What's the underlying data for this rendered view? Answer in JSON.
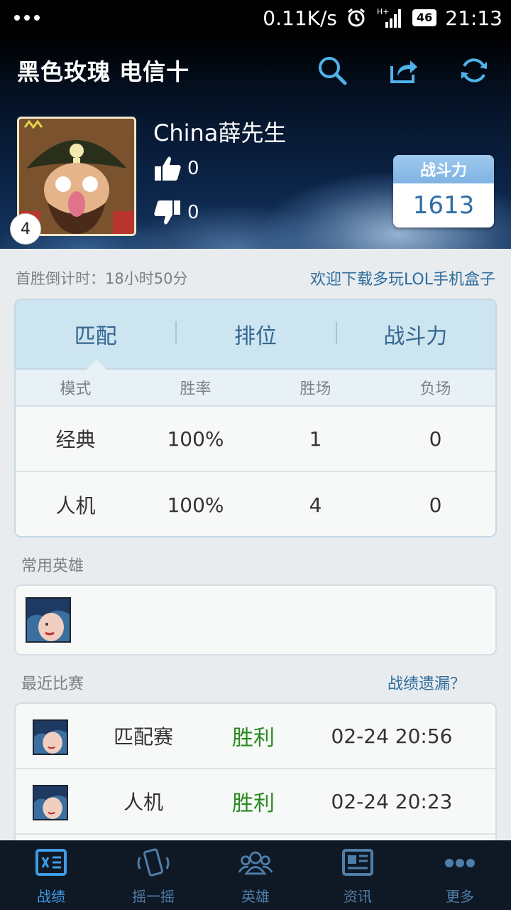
{
  "status_bar": {
    "speed": "0.11K/s",
    "network": "H+",
    "battery": "46",
    "time": "21:13"
  },
  "header": {
    "title": "黑色玫瑰 电信十",
    "actions": [
      "search-icon",
      "share-icon",
      "refresh-icon"
    ]
  },
  "profile": {
    "name": "China薛先生",
    "level": "4",
    "likes": "0",
    "dislikes": "0",
    "power_label": "战斗力",
    "power_value": "1613"
  },
  "info": {
    "countdown": "首胜倒计时：18小时50分",
    "download": "欢迎下载多玩LOL手机盒子"
  },
  "stats": {
    "tabs": [
      "匹配",
      "排位",
      "战斗力"
    ],
    "active_tab": 0,
    "columns": [
      "模式",
      "胜率",
      "胜场",
      "负场"
    ],
    "rows": [
      {
        "mode": "经典",
        "rate": "100%",
        "wins": "1",
        "losses": "0"
      },
      {
        "mode": "人机",
        "rate": "100%",
        "wins": "4",
        "losses": "0"
      }
    ]
  },
  "heroes": {
    "label": "常用英雄"
  },
  "matches": {
    "label": "最近比赛",
    "missing_link": "战绩遗漏？",
    "items": [
      {
        "type": "匹配赛",
        "result": "胜利",
        "time": "02-24 20:56"
      },
      {
        "type": "人机",
        "result": "胜利",
        "time": "02-24 20:23"
      }
    ],
    "result_color": "#2a8a1f"
  },
  "nav": {
    "items": [
      {
        "label": "战绩",
        "icon": "record-icon"
      },
      {
        "label": "摇一摇",
        "icon": "shake-icon"
      },
      {
        "label": "英雄",
        "icon": "heroes-icon"
      },
      {
        "label": "资讯",
        "icon": "news-icon"
      },
      {
        "label": "更多",
        "icon": "more-icon"
      }
    ],
    "active": 0,
    "active_color": "#3e9de6"
  }
}
